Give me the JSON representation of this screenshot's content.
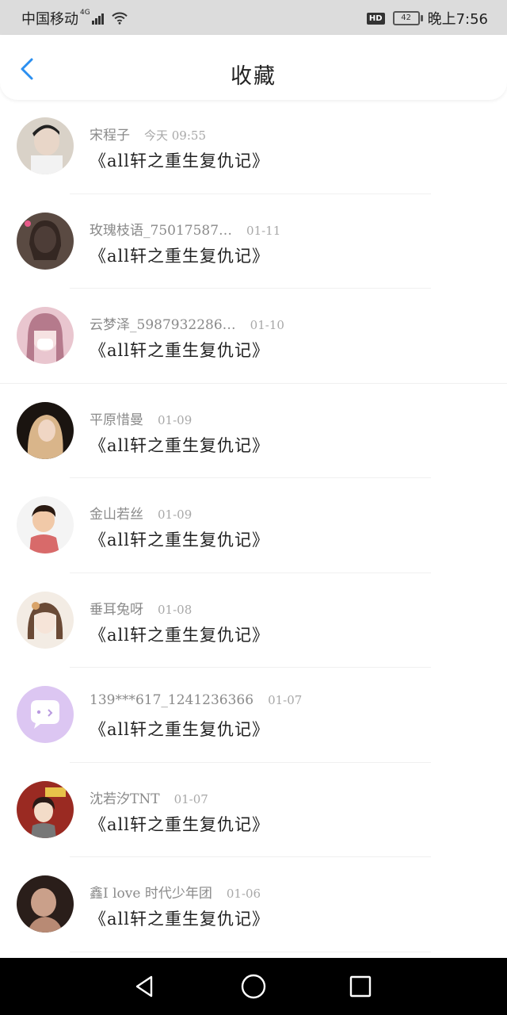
{
  "status_bar": {
    "carrier": "中国移动",
    "network": "4G",
    "hd_label": "HD",
    "battery": "42",
    "time": "晚上7:56"
  },
  "header": {
    "title": "收藏"
  },
  "favorites": [
    {
      "user": "宋程子",
      "time": "今天 09:55",
      "book": "《all轩之重生复仇记》"
    },
    {
      "user": "玫瑰枝语_75017587…",
      "time": "01-11",
      "book": "《all轩之重生复仇记》"
    },
    {
      "user": "云梦泽_5987932286…",
      "time": "01-10",
      "book": "《all轩之重生复仇记》"
    },
    {
      "user": "平原惜曼",
      "time": "01-09",
      "book": "《all轩之重生复仇记》"
    },
    {
      "user": "金山若丝",
      "time": "01-09",
      "book": "《all轩之重生复仇记》"
    },
    {
      "user": "垂耳兔呀",
      "time": "01-08",
      "book": "《all轩之重生复仇记》"
    },
    {
      "user": "139***617_1241236366",
      "time": "01-07",
      "book": "《all轩之重生复仇记》"
    },
    {
      "user": "沈若汐TNT",
      "time": "01-07",
      "book": "《all轩之重生复仇记》"
    },
    {
      "user": "鑫I love 时代少年团",
      "time": "01-06",
      "book": "《all轩之重生复仇记》"
    }
  ],
  "icons": {
    "back": "chevron-left-icon",
    "nav_back": "triangle-back-icon",
    "nav_home": "circle-home-icon",
    "nav_recent": "square-recent-icon"
  },
  "colors": {
    "accent": "#2b8ff0",
    "statusbar": "#dcdcdc",
    "navbar": "#000000"
  }
}
